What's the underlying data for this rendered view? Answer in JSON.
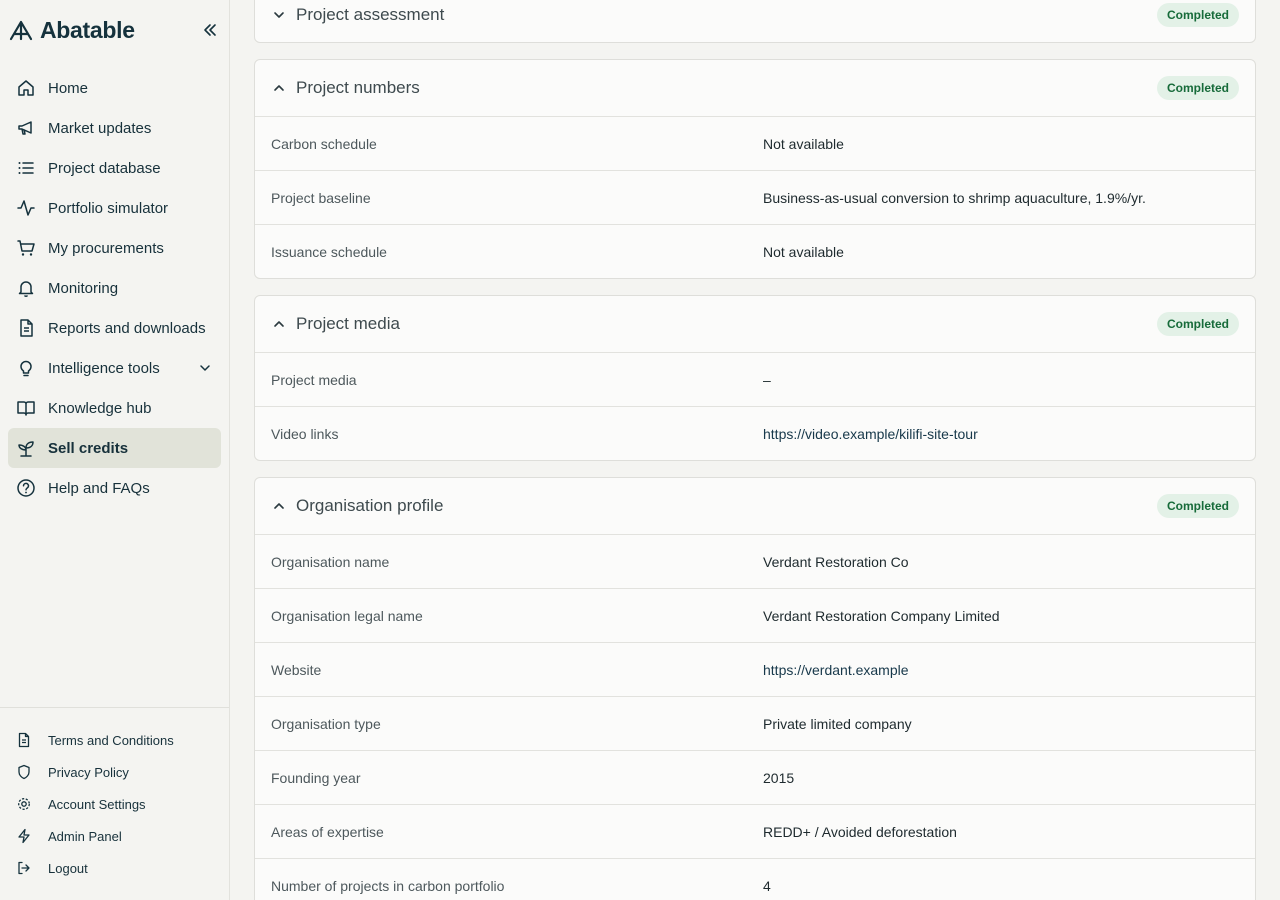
{
  "brand": {
    "name": "Abatable"
  },
  "nav": {
    "items": [
      {
        "label": "Home",
        "icon": "home-icon"
      },
      {
        "label": "Market updates",
        "icon": "megaphone-icon"
      },
      {
        "label": "Project database",
        "icon": "list-icon"
      },
      {
        "label": "Portfolio simulator",
        "icon": "activity-icon"
      },
      {
        "label": "My procurements",
        "icon": "cart-icon"
      },
      {
        "label": "Monitoring",
        "icon": "bell-icon"
      },
      {
        "label": "Reports and downloads",
        "icon": "document-icon"
      },
      {
        "label": "Intelligence tools",
        "icon": "lightbulb-icon"
      },
      {
        "label": "Knowledge hub",
        "icon": "book-icon"
      },
      {
        "label": "Sell credits",
        "icon": "sprout-icon",
        "active": true
      },
      {
        "label": "Help and FAQs",
        "icon": "help-icon"
      }
    ]
  },
  "footer_nav": {
    "items": [
      {
        "label": "Terms and Conditions",
        "icon": "document-icon"
      },
      {
        "label": "Privacy Policy",
        "icon": "shield-icon"
      },
      {
        "label": "Account Settings",
        "icon": "gear-icon"
      },
      {
        "label": "Admin Panel",
        "icon": "bolt-icon"
      },
      {
        "label": "Logout",
        "icon": "logout-icon"
      }
    ]
  },
  "sections": {
    "assessment": {
      "title": "Project assessment",
      "status": "Completed"
    },
    "numbers": {
      "title": "Project numbers",
      "status": "Completed",
      "rows": [
        {
          "key": "Carbon schedule",
          "value": "Not available"
        },
        {
          "key": "Project baseline",
          "value": "Business-as-usual conversion to shrimp aquaculture, 1.9%/yr."
        },
        {
          "key": "Issuance schedule",
          "value": "Not available"
        }
      ]
    },
    "media": {
      "title": "Project media",
      "status": "Completed",
      "rows": [
        {
          "key": "Project media",
          "value": "–"
        },
        {
          "key": "Video links",
          "value": "https://video.example/kilifi-site-tour"
        }
      ]
    },
    "org": {
      "title": "Organisation profile",
      "status": "Completed",
      "rows": [
        {
          "key": "Organisation name",
          "value": "Verdant Restoration Co"
        },
        {
          "key": "Organisation legal name",
          "value": "Verdant Restoration Company Limited"
        },
        {
          "key": "Website",
          "value": "https://verdant.example"
        },
        {
          "key": "Organisation type",
          "value": "Private limited company"
        },
        {
          "key": "Founding year",
          "value": "2015"
        },
        {
          "key": "Areas of expertise",
          "value": "REDD+ / Avoided deforestation"
        },
        {
          "key": "Number of projects in carbon portfolio",
          "value": "4"
        }
      ]
    }
  },
  "colors": {
    "accent": "#15323d",
    "badge_bg": "#e3f1e7",
    "badge_text": "#176b3a",
    "active_nav": "#e1e3d9"
  }
}
